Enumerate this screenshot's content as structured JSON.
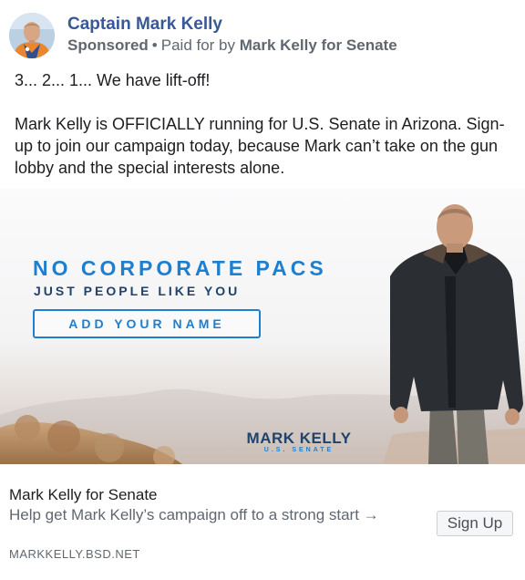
{
  "post": {
    "page_name": "Captain Mark Kelly",
    "sponsored_label": "Sponsored",
    "separator": "•",
    "paid_for_prefix": "Paid for by",
    "paid_for_by": "Mark Kelly for Senate",
    "text_line_1": "3... 2... 1... We have lift-off!",
    "text_paragraph_2": "Mark Kelly is OFFICIALLY running for U.S. Senate in Arizona. Sign-up to join our campaign today, because Mark can’t take on the gun lobby and the special interests alone."
  },
  "ad_image": {
    "headline": "NO CORPORATE PACS",
    "subhead": "JUST PEOPLE LIKE YOU",
    "button_label": "ADD YOUR NAME",
    "logo_name": "MARK KELLY",
    "logo_sub": "U.S. SENATE"
  },
  "link_preview": {
    "title": "Mark Kelly for Senate",
    "description": "Help get Mark Kelly’s campaign off to a strong start →",
    "domain": "MARKKELLY.BSD.NET",
    "cta_label": "Sign Up"
  },
  "colors": {
    "page_name": "#385898",
    "meta_text": "#606770",
    "ad_blue": "#1d7fd0",
    "ad_navy": "#20436c"
  },
  "icons": {
    "avatar": "astronaut-profile-photo"
  }
}
